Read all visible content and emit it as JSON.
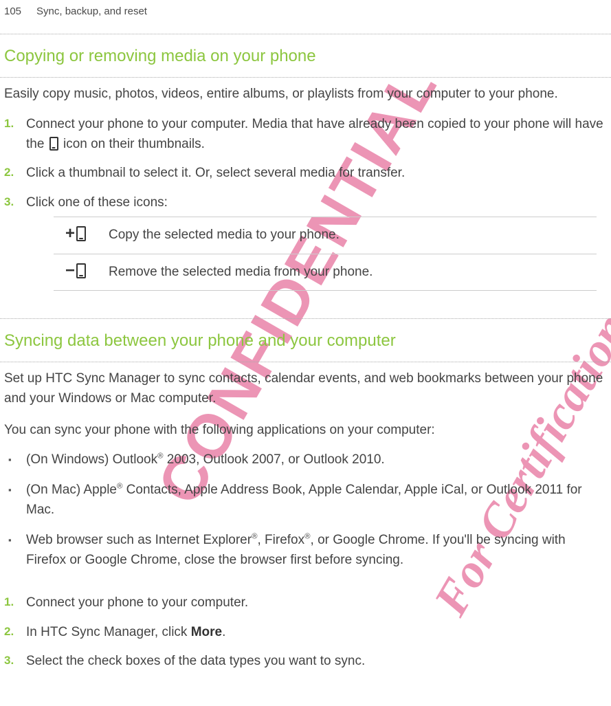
{
  "header": {
    "page_number": "105",
    "chapter_title": "Sync, backup, and reset"
  },
  "watermarks": {
    "confidential": "CONFIDENTIAL",
    "certification": "For Certification only"
  },
  "section1": {
    "heading": "Copying or removing media on your phone",
    "intro": "Easily copy music, photos, videos, entire albums, or playlists from your computer to your phone.",
    "steps": [
      {
        "num": "1.",
        "text_before": "Connect your phone to your computer. Media that have already been copied to your phone will have the ",
        "text_after": " icon on their thumbnails."
      },
      {
        "num": "2.",
        "text": "Click a thumbnail to select it. Or, select several media for transfer."
      },
      {
        "num": "3.",
        "text": "Click one of these icons:"
      }
    ],
    "icon_table": [
      {
        "sign": "+",
        "description": "Copy the selected media to your phone."
      },
      {
        "sign": "−",
        "description": "Remove the selected media from your phone."
      }
    ]
  },
  "section2": {
    "heading": "Syncing data between your phone and your computer",
    "intro1": "Set up HTC Sync Manager to sync contacts, calendar events, and web bookmarks between your phone and your Windows or Mac computer.",
    "intro2": "You can sync your phone with the following applications on your computer:",
    "bullets": [
      {
        "text_before": "(On Windows) Outlook",
        "sup1": "®",
        "text_after": " 2003, Outlook 2007, or Outlook 2010."
      },
      {
        "text_before": "(On Mac) Apple",
        "sup1": "®",
        "text_after": " Contacts, Apple Address Book, Apple Calendar, Apple iCal, or Outlook 2011 for Mac."
      },
      {
        "text_before": "Web browser such as Internet Explorer",
        "sup1": "®",
        "text_mid": ", Firefox",
        "sup2": "®",
        "text_after": ", or Google Chrome. If you'll be syncing with Firefox or Google Chrome, close the browser first before syncing."
      }
    ],
    "steps": [
      {
        "num": "1.",
        "text": "Connect your phone to your computer."
      },
      {
        "num": "2.",
        "text_before": "In HTC Sync Manager, click ",
        "bold": "More",
        "text_after": "."
      },
      {
        "num": "3.",
        "text": "Select the check boxes of the data types you want to sync."
      }
    ]
  }
}
